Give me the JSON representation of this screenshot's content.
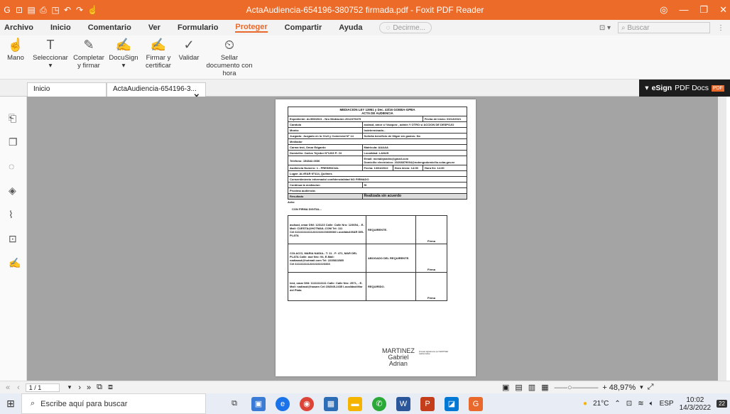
{
  "window": {
    "title": "ActaAudiencia-654196-380752 firmada.pdf - Foxit PDF Reader"
  },
  "menu": [
    {
      "label": "Archivo"
    },
    {
      "label": "Inicio"
    },
    {
      "label": "Comentario"
    },
    {
      "label": "Ver"
    },
    {
      "label": "Formulario"
    },
    {
      "label": "Proteger"
    },
    {
      "label": "Compartir"
    },
    {
      "label": "Ayuda"
    }
  ],
  "tell_me": {
    "placeholder": "Decirme..."
  },
  "search": {
    "placeholder": "Buscar"
  },
  "ribbon": [
    {
      "label": "Mano",
      "icon": "hand-icon"
    },
    {
      "label": "Seleccionar",
      "icon": "select-text-icon"
    },
    {
      "label": "Completar y firmar",
      "icon": "fill-sign-icon"
    },
    {
      "label": "DocuSign",
      "icon": "docusign-icon"
    },
    {
      "label": "Firmar y certificar",
      "icon": "sign-certify-icon"
    },
    {
      "label": "Validar",
      "icon": "validate-icon"
    },
    {
      "label": "Sellar documento con hora",
      "icon": "timestamp-icon"
    }
  ],
  "tabs": [
    {
      "label": "Inicio"
    },
    {
      "label": "ActaAudiencia-654196-3..."
    }
  ],
  "esign": {
    "brand": "eSign",
    "label": "PDF Docs",
    "badge": "PDF"
  },
  "document": {
    "header1": "MEDIACION LEY 13951 y Dec. 43/16 GOEBA-GPBA",
    "header2": "ACTA DE AUDIENCIA",
    "expediente": "Expediente: AL965/2021 - Nro Mediación 2012379475",
    "fecha_inicio": "Fecha de inicio: 03/12/2021",
    "caratula_label": "Caratula",
    "caratula_value": "asdasd, amor c/ Vazquez , admin Y OTRO s/ ACCION DE DESPOJO",
    "monto": "Monto:",
    "monto_value": "Indeterminado.-",
    "juzgado": "Juzgado: Juzgado en lo Civil y Comercial N° 14",
    "beneficio": "Solicita beneficio de litigar sin gastos: No",
    "mediador": "Mediador",
    "nombre": "Carma test, Omar Edgardo",
    "matricula": "Matricula: AAAAA",
    "domicilio": "Domicilio: Carlos Tejedor Nº1203 P: OI",
    "localidad": "Localidad: LANUS",
    "telefono": "Telefono: 154842-0036",
    "email": "Email: mchalejandra@gmail.com",
    "email_dom": "Domicilio electrónico: 20208879094@notengodomicilio.scba.gov.ar",
    "audiencia": "Audiencia Numero: 1 - PRESENCIAL",
    "fecha": "Fecha: 13/04/2022",
    "hora_inicio": "Hora inicio: 14:00",
    "hora_fin": "Hora fin: 14:30",
    "lugar": "Lugar: ALVEAR Nº414, Quilmes",
    "consentimiento": "Consentimiento informado/ confidencialidad NO FIRMADO",
    "continua": "Continua la mediacion",
    "continua_value": "SI",
    "proxima": "Proxima audiencia:",
    "resultado": "Resultado",
    "resultado_value": "Realizada sin acuerdo",
    "acta": "Acta:",
    "firma_digital": "CON FIRMA DIGITAL.-",
    "parties": [
      {
        "text": "asdsad, omar DNI: 123123 Calle: Calle Nro: 123654, - E-Mail: CUESTA@HOTMAIL.COM Tel: 111 Cel:111111111111222222223333666 Localidad:MAR DEL PLATA",
        "role": "REQUIRENTE.",
        "firma": "Firma"
      },
      {
        "text": "COLACCI, MARIA NADIA.- T: 11 - F: 471, MAR DEL PLATA Calle: asd Nro: 94, E-Mail: nadiaasd@hotmail.com Tel: 2235811585 Cel:11111111112222222223333",
        "role": "ABOGADO DEL REQUIRENTE.",
        "firma": "Firma"
      },
      {
        "text": "test, omar DNI: 11111111111 Calle: Calle Nro: 2571, - E-Mail: nadiasd@hasam Cel:154545-2435 Localidad:Mar del Plata",
        "role": "REQUIRIDO.",
        "firma": "Firma"
      }
    ],
    "signature": [
      "MARTINEZ",
      "Gabriel",
      "Adrian"
    ],
    "stamp": "Firmado digitalmente por MARTINEZ Gabriel Adrian"
  },
  "status": {
    "page": "1 / 1",
    "zoom": "+ 48,97%"
  },
  "taskbar": {
    "search_placeholder": "Escribe aquí para buscar",
    "weather": "21°C",
    "lang": "ESP",
    "time": "10:02",
    "date": "14/3/2022",
    "notif": "22"
  }
}
